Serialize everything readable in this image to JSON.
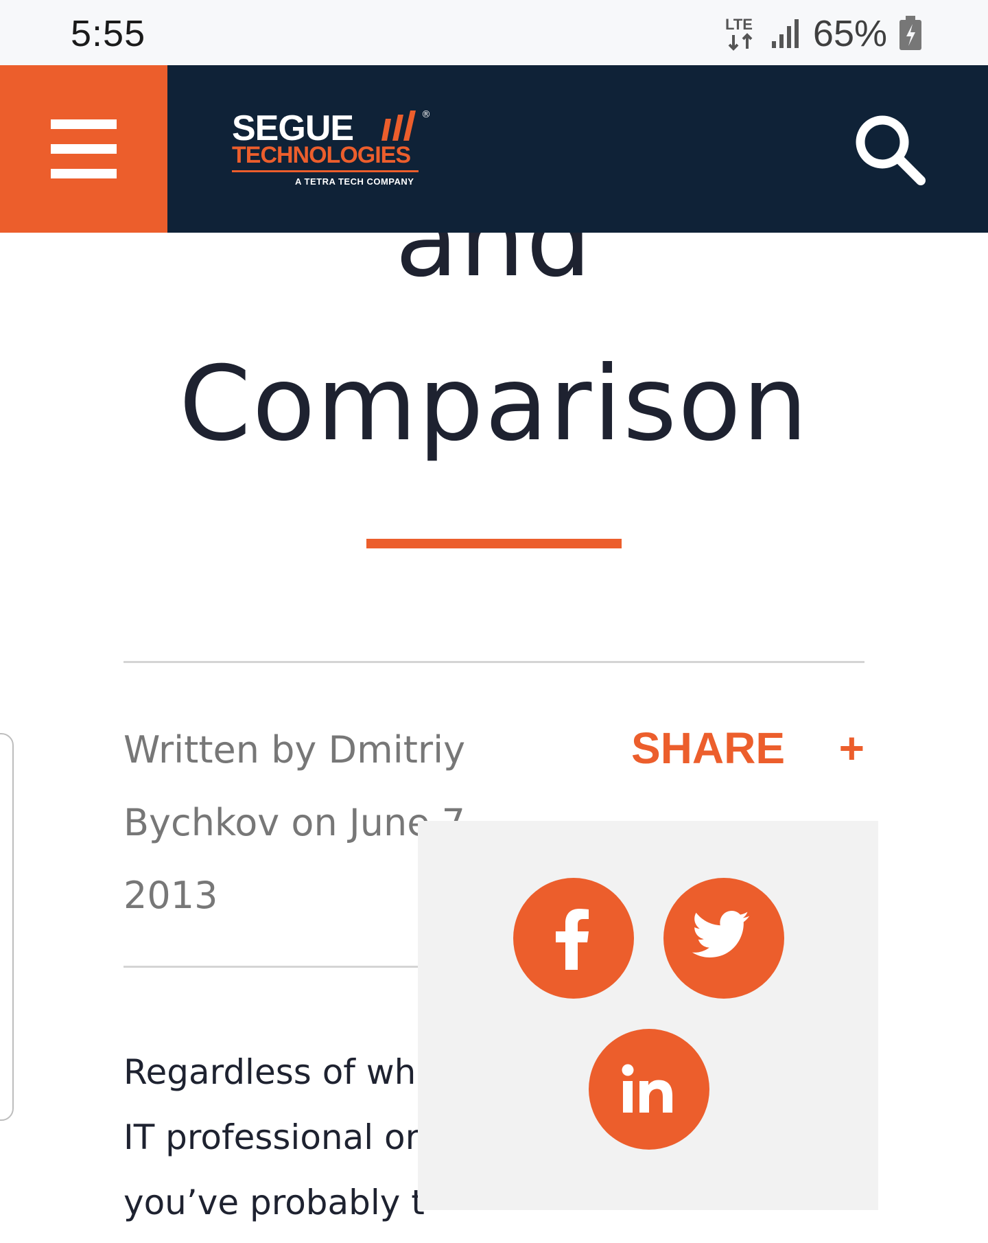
{
  "status_bar": {
    "time": "5:55",
    "network": "LTE",
    "battery": "65%",
    "icons": [
      "lte-icon",
      "signal-icon",
      "battery-charging-icon"
    ]
  },
  "header": {
    "menu_icon": "hamburger-menu-icon",
    "logo": {
      "line1": "SEGUE",
      "line2": "TECHNOLOGIES",
      "tagline": "A TETRA TECH COMPANY",
      "registered": "®"
    },
    "search_icon": "search-icon",
    "colors": {
      "background": "#0f2237",
      "accent": "#ec5e2c"
    }
  },
  "article": {
    "title_line1": "and",
    "title_line2": "Comparison",
    "byline": {
      "line1": "Written by Dmitriy",
      "line2": "Bychkov on June 7,",
      "line3": "2013"
    },
    "share": {
      "label": "SHARE",
      "toggle": "+"
    },
    "body_lines": [
      "Regardless of wh",
      "IT professional or",
      "you’ve probably t"
    ]
  },
  "share_popup": {
    "buttons": [
      {
        "name": "facebook",
        "icon": "facebook-icon"
      },
      {
        "name": "twitter",
        "icon": "twitter-icon"
      },
      {
        "name": "linkedin",
        "icon": "linkedin-icon"
      }
    ],
    "background": "#f2f2f2"
  }
}
